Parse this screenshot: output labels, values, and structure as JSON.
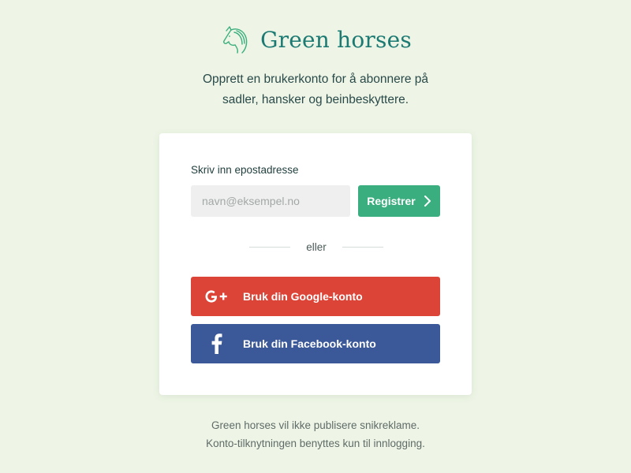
{
  "brand": {
    "logo_icon": "horse-head-icon",
    "name": "Green horses",
    "color": "#1c7a73"
  },
  "intro": {
    "line1": "Opprett en brukerkonto for å abonnere på",
    "line2": "sadler, hansker og beinbeskyttere."
  },
  "signup": {
    "email_label": "Skriv inn epostadresse",
    "email_placeholder": "navn@eksempel.no",
    "email_value": "",
    "register_label": "Registrer",
    "register_icon": "chevron-right-icon",
    "register_color": "#3aae7e"
  },
  "divider": {
    "text": "eller"
  },
  "social": {
    "google": {
      "label": "Bruk din Google-konto",
      "icon": "google-plus-icon",
      "color": "#db4437"
    },
    "facebook": {
      "label": "Bruk din Facebook-konto",
      "icon": "facebook-icon",
      "color": "#3b5998"
    }
  },
  "footer": {
    "line1": "Green horses vil ikke publisere snikreklame.",
    "line2": "Konto-tilknytningen benyttes kun til innlogging."
  },
  "colors": {
    "background": "#eef5e6",
    "card": "#ffffff"
  }
}
